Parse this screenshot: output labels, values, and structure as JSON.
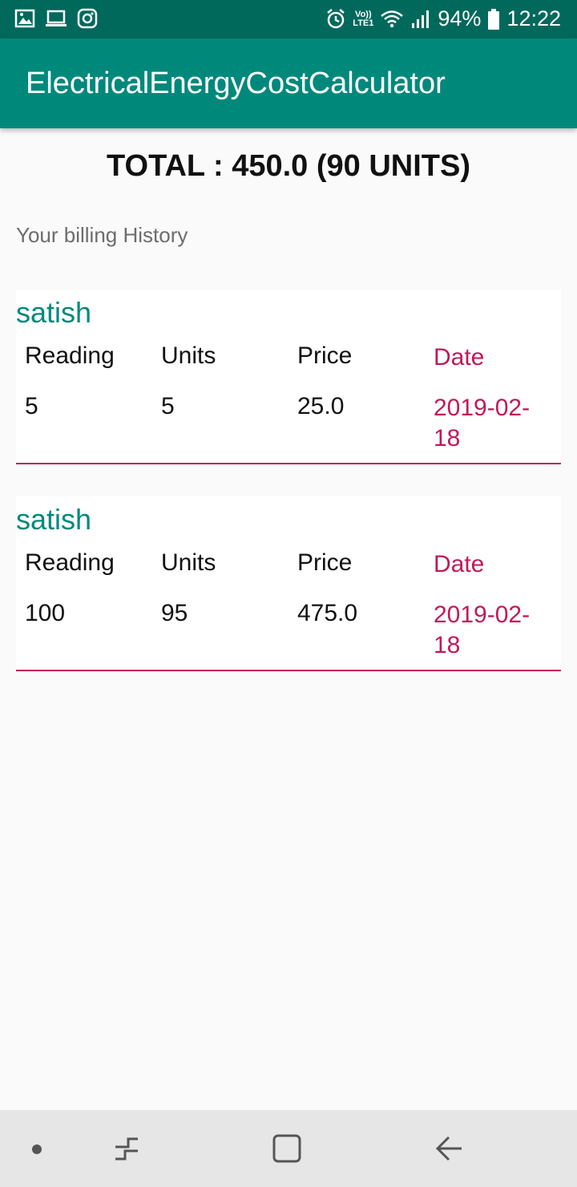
{
  "status_bar": {
    "battery_percent": "94%",
    "time": "12:22",
    "network_top": "Vo))",
    "network_bottom": "LTE1",
    "icons": [
      "gallery-icon",
      "laptop-icon",
      "instagram-icon",
      "alarm-icon",
      "wifi-icon",
      "signal-icon",
      "battery-icon"
    ]
  },
  "app_bar": {
    "title": "ElectricalEnergyCostCalculator"
  },
  "summary": {
    "total_text": "TOTAL : 450.0 (90 UNITS)"
  },
  "history": {
    "label": "Your billing History",
    "headers": {
      "reading": "Reading",
      "units": "Units",
      "price": "Price",
      "date": "Date"
    },
    "records": [
      {
        "name": "satish",
        "reading": "5",
        "units": "5",
        "price": "25.0",
        "date": "2019-02-18"
      },
      {
        "name": "satish",
        "reading": "100",
        "units": "95",
        "price": "475.0",
        "date": "2019-02-18"
      }
    ]
  },
  "colors": {
    "primary_dark": "#00695c",
    "primary": "#00897b",
    "accent": "#c2185b"
  },
  "nav_bar": {
    "icons": [
      "dot-icon",
      "recent-apps-icon",
      "home-icon",
      "back-icon"
    ]
  }
}
